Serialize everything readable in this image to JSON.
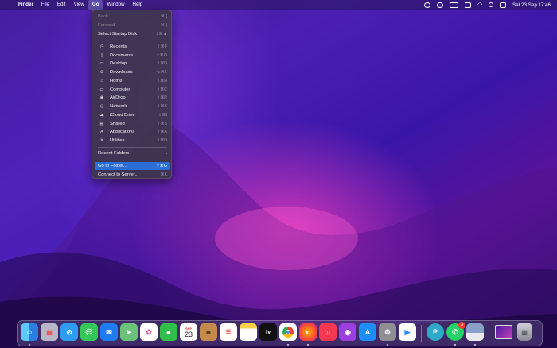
{
  "menubar": {
    "app_name": "Finder",
    "items": [
      "File",
      "Edit",
      "View",
      "Go",
      "Window",
      "Help"
    ],
    "active_item": "Go",
    "clock": "Sat 23 Sep  17:46"
  },
  "go_menu": {
    "items": [
      {
        "label": "Back",
        "shortcut": "⌘ [",
        "icon": "",
        "disabled": true
      },
      {
        "label": "Forward",
        "shortcut": "⌘ ]",
        "icon": "",
        "disabled": true
      },
      {
        "label": "Select Startup Disk",
        "shortcut": "⇧⌘▲",
        "icon": "",
        "disabled": false
      },
      {
        "label": "Recents",
        "shortcut": "⇧⌘F",
        "icon": "clock-icon"
      },
      {
        "label": "Documents",
        "shortcut": "⇧⌘O",
        "icon": "document-icon"
      },
      {
        "label": "Desktop",
        "shortcut": "⇧⌘D",
        "icon": "desktop-icon"
      },
      {
        "label": "Downloads",
        "shortcut": "⌥⌘L",
        "icon": "download-icon"
      },
      {
        "label": "Home",
        "shortcut": "⇧⌘H",
        "icon": "home-icon"
      },
      {
        "label": "Computer",
        "shortcut": "⇧⌘C",
        "icon": "computer-icon"
      },
      {
        "label": "AirDrop",
        "shortcut": "⇧⌘R",
        "icon": "airdrop-icon"
      },
      {
        "label": "Network",
        "shortcut": "⇧⌘K",
        "icon": "network-icon"
      },
      {
        "label": "iCloud Drive",
        "shortcut": "⇧⌘I",
        "icon": "cloud-icon"
      },
      {
        "label": "Shared",
        "shortcut": "⇧⌘S",
        "icon": "shared-folder-icon"
      },
      {
        "label": "Applications",
        "shortcut": "⇧⌘A",
        "icon": "applications-icon"
      },
      {
        "label": "Utilities",
        "shortcut": "⇧⌘U",
        "icon": "utilities-icon"
      },
      {
        "label": "Recent Folders",
        "shortcut": "›",
        "icon": ""
      },
      {
        "label": "Go to Folder...",
        "shortcut": "⇧⌘G",
        "icon": "",
        "highlighted": true
      },
      {
        "label": "Connect to Server...",
        "shortcut": "⌘K",
        "icon": ""
      }
    ]
  },
  "dock": {
    "calendar_day": "23",
    "calendar_month": "SEP",
    "tv_label": "tv",
    "whatsapp_badge": "3",
    "apps": [
      "Finder",
      "Launchpad",
      "Safari",
      "Messages",
      "Mail",
      "Maps",
      "Photos",
      "FaceTime",
      "Calendar",
      "Contacts",
      "Reminders",
      "Notes",
      "TV",
      "Chrome",
      "Firefox",
      "Music",
      "Podcasts",
      "App Store",
      "System Preferences",
      "Zoom",
      "Pythonista",
      "WhatsApp",
      "Preview",
      "Screenshot",
      "Trash"
    ]
  },
  "colors": {
    "highlight": "#2b6fd6",
    "menu_bg": "#3c3746"
  }
}
